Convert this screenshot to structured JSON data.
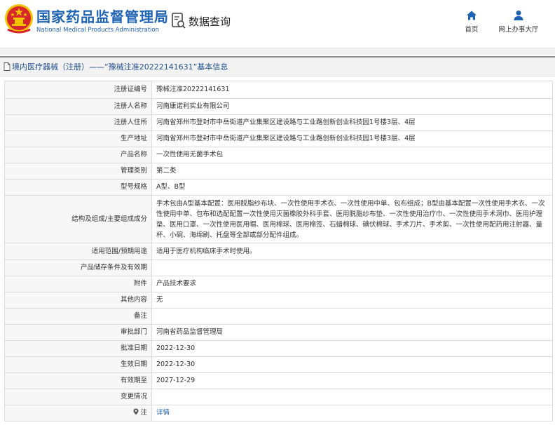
{
  "header": {
    "site_title": "国家药品监督管理局",
    "site_subtitle": "National Medical Products Administration",
    "search_label": "数据查询",
    "nav": [
      {
        "label": "首页",
        "icon": "home-icon"
      },
      {
        "label": "网上办事大厅",
        "icon": "user-icon"
      }
    ]
  },
  "title_bar": {
    "text": "境内医疗器械（注册）——“豫械注准20222141631”基本信息"
  },
  "rows": [
    {
      "label": "注册证编号",
      "value": "豫械注准20222141631"
    },
    {
      "label": "注册人名称",
      "value": "河南康诺利实业有限公司"
    },
    {
      "label": "注册人住所",
      "value": "河南省郑州市登封市中岳街道产业集聚区建设路与工业路创新创业科技园1号楼3层、4层"
    },
    {
      "label": "生产地址",
      "value": "河南省郑州市登封市中岳街道产业集聚区建设路与工业路创新创业科技园1号楼3层、4层"
    },
    {
      "label": "产品名称",
      "value": "一次性使用无菌手术包"
    },
    {
      "label": "管理类别",
      "value": "第二类"
    },
    {
      "label": "型号规格",
      "value": "A型、B型"
    },
    {
      "label": "结构及组成/主要组成成分",
      "value": "手术包由A型基本配置：医用脱脂纱布块、一次性使用手术衣、一次性使用中单、包布组成；B型由基本配置一次性使用手术衣、一次性使用中单、包布和选配配置一次性使用灭菌橡胶外科手套、医用脱脂纱布垫、一次性使用治疗巾、一次性使用手术洞巾、医用护理垫、医用口罩、一次性使用医用帽、医用棉球、医用棉签、石蜡棉球、碘伏棉球、手术刀片、手术剪、一次性使用配药用注射器、量杯、小碗、海绵刷、托盘等全部或部分配件组成。"
    },
    {
      "label": "适用范围/预期用途",
      "value": "适用于医疗机构临床手术时使用。"
    },
    {
      "label": "产品储存条件及有效期",
      "value": ""
    },
    {
      "label": "附件",
      "value": "产品技术要求"
    },
    {
      "label": "其他内容",
      "value": "无"
    },
    {
      "label": "备注",
      "value": ""
    },
    {
      "label": "审批部门",
      "value": "河南省药品监督管理局"
    },
    {
      "label": "批准日期",
      "value": "2022-12-30"
    },
    {
      "label": "生效日期",
      "value": "2022-12-30"
    },
    {
      "label": "有效期至",
      "value": "2027-12-29"
    },
    {
      "label": "变更情况",
      "value": ""
    },
    {
      "label": "注",
      "value": "详情"
    }
  ],
  "colors": {
    "brand_blue": "#1f63b5",
    "emblem_red": "#d7262b",
    "emblem_gold": "#f2c200"
  }
}
